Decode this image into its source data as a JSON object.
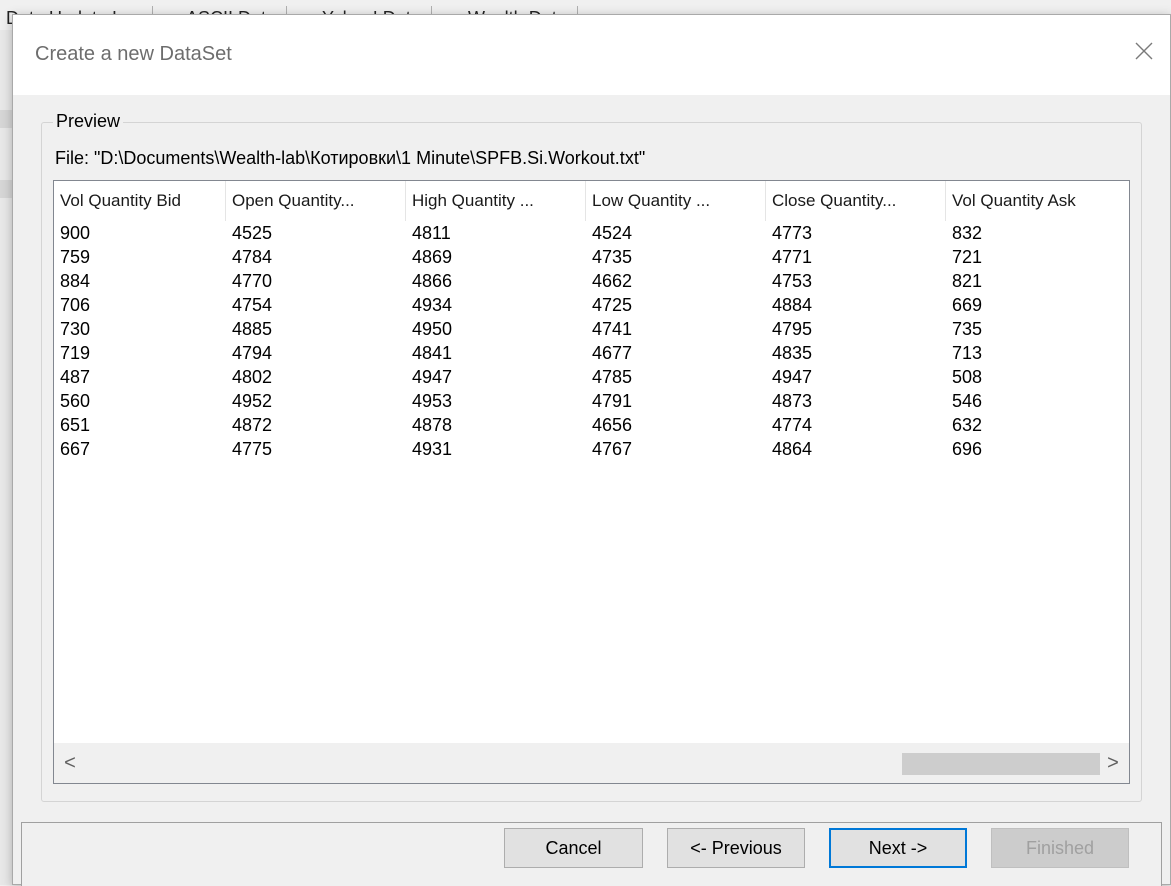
{
  "background_tabs": [
    "Data Update Log",
    "ASCII Data",
    "Yahoo! Data",
    "Wealth Data"
  ],
  "dialog": {
    "title": "Create a new DataSet",
    "close_icon": "close-icon"
  },
  "preview": {
    "legend": "Preview",
    "file_label": "File: \"D:\\Documents\\Wealth-lab\\Котировки\\1 Minute\\SPFB.Si.Workout.txt\""
  },
  "table": {
    "columns": [
      "Vol Quantity Bid",
      "Open Quantity...",
      "High Quantity ...",
      "Low Quantity ...",
      "Close Quantity...",
      "Vol Quantity Ask"
    ],
    "rows": [
      [
        "900",
        "4525",
        "4811",
        "4524",
        "4773",
        "832"
      ],
      [
        "759",
        "4784",
        "4869",
        "4735",
        "4771",
        "721"
      ],
      [
        "884",
        "4770",
        "4866",
        "4662",
        "4753",
        "821"
      ],
      [
        "706",
        "4754",
        "4934",
        "4725",
        "4884",
        "669"
      ],
      [
        "730",
        "4885",
        "4950",
        "4741",
        "4795",
        "735"
      ],
      [
        "719",
        "4794",
        "4841",
        "4677",
        "4835",
        "713"
      ],
      [
        "487",
        "4802",
        "4947",
        "4785",
        "4947",
        "508"
      ],
      [
        "560",
        "4952",
        "4953",
        "4791",
        "4873",
        "546"
      ],
      [
        "651",
        "4872",
        "4878",
        "4656",
        "4774",
        "632"
      ],
      [
        "667",
        "4775",
        "4931",
        "4767",
        "4864",
        "696"
      ]
    ],
    "scroll_left": "<",
    "scroll_right": ">"
  },
  "buttons": {
    "cancel": "Cancel",
    "previous": "<- Previous",
    "next": "Next ->",
    "finished": "Finished"
  },
  "colors": {
    "accent": "#0078d7",
    "disabled_text": "#a0a0a0"
  }
}
